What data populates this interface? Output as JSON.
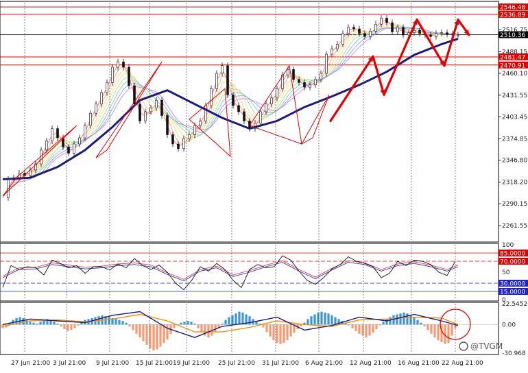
{
  "chart_data": [
    {
      "type": "line",
      "panel": "price",
      "series": [
        {
          "kind": "price",
          "x": [
            0,
            8,
            16,
            24,
            32,
            40,
            48,
            56,
            64,
            72,
            80,
            88,
            96,
            104,
            112,
            120,
            128,
            136,
            144,
            152,
            160,
            168,
            176,
            184,
            192,
            200,
            208,
            216,
            224,
            232,
            240,
            248,
            256,
            264,
            272,
            280,
            288,
            296,
            304,
            312,
            320,
            328,
            336,
            344,
            352,
            360,
            368,
            376,
            384,
            392,
            400,
            408,
            416,
            424,
            432,
            440,
            448,
            456,
            464,
            472,
            480,
            488,
            496,
            504,
            512,
            520,
            528,
            536,
            544,
            552,
            560,
            568,
            576,
            584,
            592,
            600,
            608,
            616,
            624,
            632,
            640,
            648,
            656,
            664
          ],
          "values": [
            2298,
            2322,
            2324,
            2330,
            2327,
            2334,
            2342,
            2360,
            2372,
            2388,
            2376,
            2364,
            2356,
            2368,
            2376,
            2392,
            2408,
            2420,
            2435,
            2448,
            2468,
            2475,
            2468,
            2444,
            2420,
            2398,
            2410,
            2415,
            2425,
            2405,
            2380,
            2368,
            2362,
            2375,
            2380,
            2392,
            2398,
            2418,
            2440,
            2460,
            2470,
            2432,
            2418,
            2410,
            2398,
            2388,
            2395,
            2410,
            2420,
            2428,
            2440,
            2458,
            2465,
            2452,
            2448,
            2442,
            2445,
            2452,
            2460,
            2485,
            2492,
            2498,
            2512,
            2520,
            2518,
            2512,
            2508,
            2515,
            2524,
            2532,
            2526,
            2514,
            2520,
            2510,
            2513,
            2516,
            2512,
            2510,
            2508,
            2512,
            2513,
            2511,
            2510,
            2510
          ]
        },
        {
          "kind": "ma-slow",
          "x": [
            0,
            40,
            80,
            120,
            160,
            200,
            240,
            280,
            320,
            360,
            400,
            440,
            480,
            520,
            560,
            600,
            640,
            664
          ],
          "values": [
            2322,
            2324,
            2338,
            2360,
            2390,
            2425,
            2438,
            2420,
            2402,
            2388,
            2398,
            2416,
            2430,
            2445,
            2462,
            2484,
            2498,
            2505
          ]
        }
      ],
      "y_ticks": [
        "2546.48",
        "2536.89",
        "2516.75",
        "2488.15",
        "2481.47",
        "2470.91",
        "2460.10",
        "2431.55",
        "2403.45",
        "2374.85",
        "2346.80",
        "2318.20",
        "2290.15",
        "2261.55"
      ],
      "ylim": [
        2242,
        2552
      ],
      "price_lines": [
        {
          "value": 2546.48,
          "label": "2546.48",
          "color": "#e00000"
        },
        {
          "value": 2536.89,
          "label": "2536.89",
          "color": "#e00000"
        },
        {
          "value": 2510.36,
          "label": "2510.36",
          "color": "#000000"
        },
        {
          "value": 2481.47,
          "label": "2481.47",
          "color": "#e00000"
        },
        {
          "value": 2470.91,
          "label": "2470.91",
          "color": "#e00000"
        }
      ],
      "colors": {
        "price": "#111111",
        "ma_slow": "#1b1b7a",
        "channels": "#e00000",
        "levels": "#e00000",
        "bid": "#000000"
      }
    },
    {
      "type": "line",
      "panel": "oscillator",
      "ylim": [
        0,
        100
      ],
      "levels": [
        {
          "value": 85,
          "label": "85.0000",
          "color": "#e00000"
        },
        {
          "value": 70,
          "label": "70.0000",
          "color": "#e00000"
        },
        {
          "value": 30,
          "label": "30.0000",
          "color": "#2222cc"
        },
        {
          "value": 15,
          "label": "15.0000",
          "color": "#2222cc"
        }
      ],
      "y_ticks": [
        "100",
        "50",
        "0"
      ],
      "series": [
        {
          "x": [
            0,
            12,
            24,
            36,
            48,
            60,
            72,
            84,
            96,
            108,
            120,
            132,
            144,
            156,
            168,
            180,
            192,
            204,
            216,
            228,
            240,
            252,
            264,
            276,
            288,
            300,
            312,
            324,
            336,
            348,
            360,
            372,
            384,
            396,
            408,
            420,
            432,
            444,
            456,
            468,
            480,
            492,
            504,
            516,
            528,
            540,
            552,
            564,
            576,
            588,
            600,
            612,
            624,
            636,
            648,
            660
          ],
          "values": [
            22,
            62,
            55,
            60,
            58,
            45,
            72,
            66,
            58,
            62,
            48,
            60,
            60,
            54,
            65,
            58,
            75,
            62,
            55,
            63,
            50,
            30,
            18,
            36,
            60,
            52,
            66,
            55,
            35,
            22,
            55,
            64,
            58,
            60,
            80,
            72,
            52,
            35,
            28,
            40,
            56,
            64,
            78,
            70,
            66,
            60,
            40,
            48,
            70,
            62,
            72,
            70,
            64,
            50,
            44,
            70
          ]
        },
        {
          "x": [
            0,
            24,
            48,
            72,
            96,
            120,
            144,
            168,
            192,
            216,
            240,
            264,
            288,
            312,
            336,
            360,
            384,
            408,
            432,
            456,
            480,
            504,
            528,
            552,
            576,
            600,
            624,
            648,
            664
          ],
          "values": [
            40,
            55,
            56,
            64,
            60,
            56,
            58,
            62,
            64,
            60,
            46,
            34,
            52,
            58,
            42,
            50,
            60,
            68,
            52,
            38,
            54,
            68,
            64,
            52,
            62,
            66,
            60,
            52,
            60
          ]
        }
      ],
      "colors": {
        "osc_main": "#111111",
        "osc_signal_1": "#e04040",
        "osc_signal_2": "#3030c0"
      }
    },
    {
      "type": "bar",
      "panel": "macd",
      "y_ticks": [
        "22.5452",
        "0.00",
        "-30.968"
      ],
      "ylim": [
        -30.968,
        22.5452
      ],
      "histogram": {
        "x": [
          0,
          5,
          10,
          15,
          20,
          25,
          30,
          35,
          40,
          45,
          50,
          55,
          60,
          65,
          70,
          75,
          80,
          85,
          90,
          95,
          100,
          105,
          110,
          115,
          120,
          125,
          130,
          135,
          140,
          145,
          150,
          155,
          160,
          165,
          170,
          175,
          180,
          185,
          190,
          195,
          200,
          205,
          210,
          215,
          220,
          225,
          230,
          235,
          240,
          245,
          250,
          255,
          260,
          265,
          270,
          275,
          280,
          285,
          290,
          295,
          300,
          305,
          310,
          315,
          320,
          325,
          330,
          335,
          340,
          345,
          350,
          355,
          360,
          365,
          370,
          375,
          380,
          385,
          390,
          395,
          400,
          405,
          410,
          415,
          420,
          425,
          430,
          435,
          440,
          445,
          450,
          455,
          460,
          465,
          470,
          475,
          480,
          485,
          490,
          495,
          500,
          505,
          510,
          515,
          520,
          525,
          530,
          535,
          540,
          545,
          550,
          555,
          560,
          565,
          570,
          575,
          580,
          585,
          590,
          595,
          600,
          605,
          610,
          615,
          620,
          625,
          630,
          635,
          640,
          645,
          650,
          655,
          660
        ],
        "values": [
          -4,
          -3,
          2,
          5,
          7,
          8,
          7,
          5,
          3,
          2,
          1,
          3,
          5,
          6,
          5,
          3,
          1,
          -2,
          -5,
          -7,
          -6,
          -4,
          -1,
          3,
          5,
          6,
          7,
          8,
          9,
          10,
          9,
          8,
          7,
          6,
          5,
          4,
          2,
          -2,
          -6,
          -10,
          -14,
          -18,
          -22,
          -26,
          -28,
          -27,
          -24,
          -20,
          -16,
          -10,
          -4,
          0,
          2,
          3,
          4,
          3,
          1,
          -4,
          -8,
          -12,
          -14,
          -12,
          -8,
          -4,
          1,
          5,
          8,
          10,
          12,
          14,
          13,
          11,
          9,
          6,
          3,
          1,
          -3,
          -8,
          -13,
          -17,
          -20,
          -21,
          -20,
          -17,
          -13,
          -9,
          -5,
          -2,
          2,
          6,
          9,
          11,
          13,
          14,
          13,
          12,
          10,
          8,
          6,
          4,
          2,
          -1,
          -4,
          -7,
          -10,
          -12,
          -14,
          -12,
          -9,
          -5,
          -1,
          3,
          6,
          8,
          10,
          11,
          12,
          13,
          12,
          10,
          8,
          5,
          2,
          -2,
          -6,
          -10,
          -14,
          -17,
          -19,
          -21,
          -20,
          -12,
          -4,
          2
        ]
      },
      "series": [
        {
          "name": "",
          "x": [
            0,
            40,
            80,
            120,
            160,
            200,
            240,
            280,
            320,
            360,
            400,
            440,
            480,
            520,
            560,
            600,
            640,
            664
          ],
          "values": [
            0,
            6,
            4,
            2,
            10,
            14,
            -4,
            -14,
            -2,
            2,
            8,
            -6,
            -1,
            8,
            4,
            11,
            4,
            -1
          ]
        },
        {
          "name": "",
          "x": [
            0,
            40,
            80,
            120,
            160,
            200,
            240,
            280,
            320,
            360,
            400,
            440,
            480,
            520,
            560,
            600,
            640,
            664
          ],
          "values": [
            -2,
            4,
            5,
            3,
            6,
            11,
            4,
            -8,
            -8,
            -3,
            4,
            0,
            -2,
            5,
            6,
            8,
            7,
            0
          ]
        }
      ],
      "colors": {
        "hist_pos": "#3a98d8",
        "hist_neg": "#f39a72",
        "macd": "#1b1b7a",
        "signal": "#f0900a",
        "circle": "#e00000"
      }
    }
  ],
  "x_labels": [
    "27 Jun 21:00",
    "3 Jul 21:00",
    "9 Jul 21:00",
    "15 Jul 21:00",
    "19 Jul 21:00",
    "25 Jul 21:00",
    "31 Jul 21:00",
    "6 Aug 21:00",
    "12 Aug 21:00",
    "16 Aug 21:00",
    "22 Aug 21:00"
  ],
  "watermark": "@TVGM"
}
